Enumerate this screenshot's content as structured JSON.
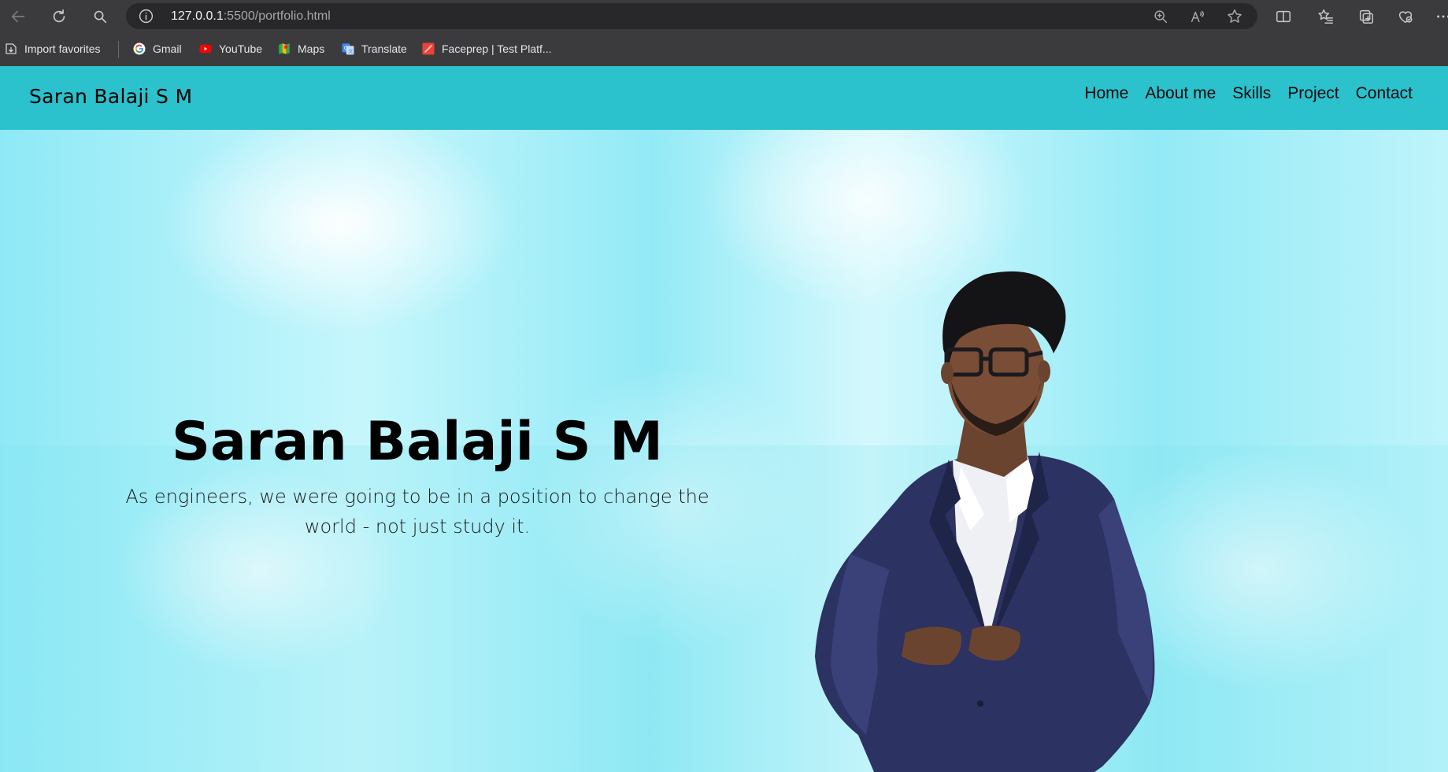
{
  "browser": {
    "url_host": "127.0.0.1",
    "url_path": ":5500/portfolio.html",
    "icons": {
      "back": "back-arrow-icon",
      "refresh": "refresh-icon",
      "search": "search-icon",
      "info": "info-icon",
      "zoom": "zoom-icon",
      "read_aloud": "read-aloud-icon",
      "favorite": "star-icon",
      "split_screen": "split-screen-icon",
      "favorites": "favorites-list-icon",
      "collections": "collections-icon",
      "health": "browser-essentials-icon",
      "more": "more-icon"
    }
  },
  "bookmarks": [
    {
      "label": "Import favorites",
      "icon": "import-icon"
    },
    {
      "label": "Gmail",
      "icon": "google-icon"
    },
    {
      "label": "YouTube",
      "icon": "youtube-icon"
    },
    {
      "label": "Maps",
      "icon": "maps-icon"
    },
    {
      "label": "Translate",
      "icon": "translate-icon"
    },
    {
      "label": "Faceprep | Test Platf...",
      "icon": "faceprep-icon"
    }
  ],
  "site": {
    "brand": "Saran Balaji S M",
    "nav": [
      "Home",
      "About me",
      "Skills",
      "Project",
      "Contact"
    ],
    "hero": {
      "name": "Saran Balaji S M",
      "quote": "As engineers, we were going to be in a position to change the world - not just study it."
    },
    "colors": {
      "navbar": "#2bc1cd",
      "hero_background": "#8ee9f6",
      "browser_chrome": "#3b3b3d"
    }
  }
}
